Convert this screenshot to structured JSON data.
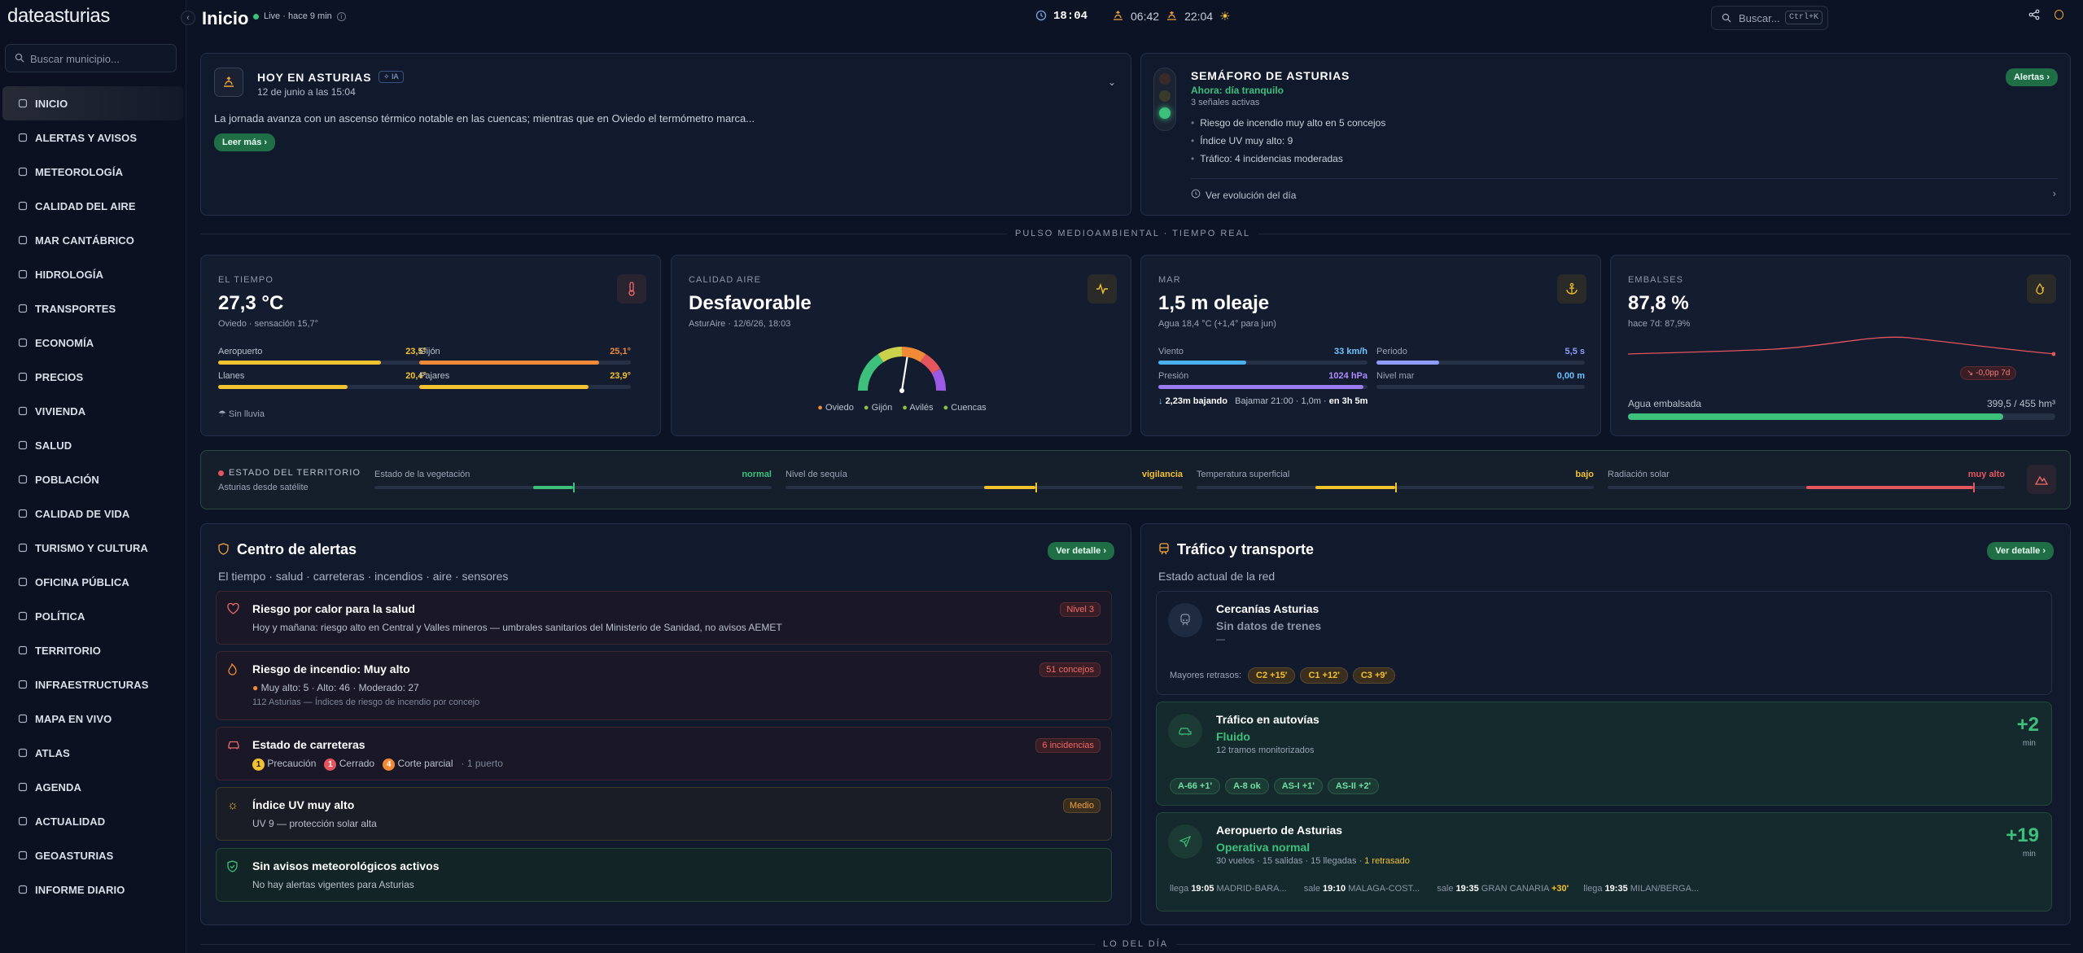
{
  "app": {
    "logo": "dateasturias",
    "search_placeholder": "Buscar municipio..."
  },
  "nav": [
    "INICIO",
    "ALERTAS Y AVISOS",
    "METEOROLOGÍA",
    "CALIDAD DEL AIRE",
    "MAR CANTÁBRICO",
    "HIDROLOGÍA",
    "TRANSPORTES",
    "ECONOMÍA",
    "PRECIOS",
    "VIVIENDA",
    "SALUD",
    "POBLACIÓN",
    "CALIDAD DE VIDA",
    "TURISMO Y CULTURA",
    "OFICINA PÚBLICA",
    "POLÍTICA",
    "TERRITORIO",
    "INFRAESTRUCTURAS",
    "MAPA EN VIVO",
    "ATLAS",
    "AGENDA",
    "ACTUALIDAD",
    "GEOASTURIAS",
    "INFORME DIARIO"
  ],
  "header": {
    "title": "Inicio",
    "live": "Live · hace 9 min",
    "time": "18:04",
    "sunrise": "06:42",
    "sunset": "22:04",
    "search": "Buscar...",
    "kbd": "Ctrl+K"
  },
  "today": {
    "title": "HOY EN ASTURIAS",
    "ia": "IA",
    "date": "12 de junio a las 15:04",
    "text": "La jornada avanza con un ascenso térmico notable en las cuencas; mientras que en Oviedo el termómetro marca...",
    "more": "Leer más"
  },
  "semaforo": {
    "title": "SEMÁFORO DE ASTURIAS",
    "status": "Ahora: día tranquilo",
    "signals": "3 señales activas",
    "items": [
      "Riesgo de incendio muy alto en 5 concejos",
      "Índice UV muy alto: 9",
      "Tráfico: 4 incidencias moderadas"
    ],
    "link": "Ver evolución del día",
    "button": "Alertas"
  },
  "pulse": "PULSO MEDIOAMBIENTAL · TIEMPO REAL",
  "tiempo": {
    "label": "EL TIEMPO",
    "value": "27,3 °C",
    "sub": "Oviedo · sensación 15,7°",
    "cities": [
      {
        "name": "Aeropuerto",
        "v": "23,5°",
        "pct": 0.78,
        "color": "#f2c12e"
      },
      {
        "name": "Gijón",
        "v": "25,1°",
        "pct": 0.85,
        "color": "#f08a36"
      },
      {
        "name": "Llanes",
        "v": "20,4°",
        "pct": 0.62,
        "color": "#f2c12e"
      },
      {
        "name": "Pajares",
        "v": "23,9°",
        "pct": 0.8,
        "color": "#f2c12e"
      }
    ],
    "rain": "Sin lluvia"
  },
  "aire": {
    "label": "CALIDAD AIRE",
    "value": "Desfavorable",
    "sub": "AsturAire · 12/6/26, 18:03",
    "gauge": 0.55,
    "legend": [
      {
        "name": "Oviedo",
        "color": "#f08a36"
      },
      {
        "name": "Gijón",
        "color": "#8fc23d"
      },
      {
        "name": "Avilés",
        "color": "#8fc23d"
      },
      {
        "name": "Cuencas",
        "color": "#8fc23d"
      }
    ]
  },
  "mar": {
    "label": "MAR",
    "value": "1,5 m oleaje",
    "sub": "Agua 18,4 °C (+1,4° para jun)",
    "viento_l": "Viento",
    "viento": "33 km/h",
    "viento_pct": 0.42,
    "periodo_l": "Periodo",
    "periodo": "5,5 s",
    "periodo_pct": 0.3,
    "presion_l": "Presión",
    "presion": "1024 hPa",
    "presion_pct": 0.98,
    "nivel_l": "Nivel mar",
    "nivel": "0,00 m",
    "nivel_pct": 0,
    "tide": "2,23m bajando",
    "tide2": "Bajamar 21:00 · 1,0m ·",
    "tide3": "en 3h 5m"
  },
  "embalses": {
    "label": "EMBALSES",
    "value": "87,8 %",
    "sub": "hace 7d: 87,9%",
    "delta": "-0,0pp 7d",
    "agua_l": "Agua embalsada",
    "agua": "399,5 / 455 hm³",
    "pct": 0.878
  },
  "territorio": {
    "title": "ESTADO DEL TERRITORIO",
    "sub": "Asturias desde satélite",
    "items": [
      {
        "name": "Estado de la vegetación",
        "v": "normal",
        "color": "#3cc07c",
        "a": 0.4,
        "b": 0.5
      },
      {
        "name": "Nivel de sequía",
        "v": "vigilancia",
        "color": "#f2c12e",
        "a": 0.5,
        "b": 0.63
      },
      {
        "name": "Temperatura superficial",
        "v": "bajo",
        "color": "#f2c12e",
        "a": 0.3,
        "b": 0.5
      },
      {
        "name": "Radiación solar",
        "v": "muy alto",
        "color": "#e5555d",
        "a": 0.5,
        "b": 0.92
      }
    ]
  },
  "alertas": {
    "title": "Centro de alertas",
    "sub": "El tiempo · salud · carreteras · incendios · aire · sensores",
    "button": "Ver detalle",
    "items": [
      {
        "t": "Riesgo por calor para la salud",
        "s": "Hoy y mañana: riesgo alto en Central y Valles mineros — umbrales sanitarios del Ministerio de Sanidad, no avisos AEMET",
        "badge": "Nivel 3",
        "icon": "heart-icon"
      },
      {
        "t": "Riesgo de incendio: Muy alto",
        "s": "Muy alto: 5 · Alto: 46 · Moderado: 27",
        "s2": "112 Asturias — Índices de riesgo de incendio por concejo",
        "badge": "51 concejos",
        "icon": "flame-icon"
      },
      {
        "t": "Estado de carreteras",
        "s1": "Precaución",
        "s2": "Cerrado",
        "s3": "Corte parcial",
        "s4": "· 1 puerto",
        "n1": "1",
        "n2": "1",
        "n3": "4",
        "badge": "6 incidencias",
        "icon": "car-icon"
      },
      {
        "t": "Índice UV muy alto",
        "s": "UV 9 — protección solar alta",
        "badge": "Medio",
        "icon": "sun-icon"
      },
      {
        "t": "Sin avisos meteorológicos activos",
        "s": "No hay alertas vigentes para Asturias",
        "icon": "shield-check-icon"
      }
    ]
  },
  "trafico": {
    "title": "Tráfico y transporte",
    "sub": "Estado actual de la red",
    "button": "Ver detalle",
    "cercanias": {
      "t": "Cercanías Asturias",
      "s": "Sin datos de trenes",
      "dash": "—",
      "retrasos": "Mayores retrasos:",
      "chips": [
        "C2 +15'",
        "C1 +12'",
        "C3 +9'"
      ]
    },
    "autovias": {
      "t": "Tráfico en autovías",
      "s": "Fluido",
      "sub": "12 tramos monitorizados",
      "delta": "+2",
      "unit": "min",
      "chips": [
        "A-66 +1'",
        "A-8 ok",
        "AS-I +1'",
        "AS-II +2'"
      ]
    },
    "aeropuerto": {
      "t": "Aeropuerto de Asturias",
      "s": "Operativa normal",
      "sub": "30 vuelos · 15 salidas · 15 llegadas ·",
      "late": "1 retrasado",
      "delta": "+19",
      "unit": "min",
      "flights": [
        {
          "k": "llega",
          "t": "19:05",
          "d": "MADRID-BARA...",
          "x": ""
        },
        {
          "k": "sale",
          "t": "19:10",
          "d": "MALAGA-COST...",
          "x": ""
        },
        {
          "k": "sale",
          "t": "19:35",
          "d": "GRAN CANARIA",
          "x": "+30'"
        },
        {
          "k": "llega",
          "t": "19:35",
          "d": "MILAN/BERGA...",
          "x": ""
        }
      ]
    }
  },
  "footer": "LO DEL DÍA"
}
